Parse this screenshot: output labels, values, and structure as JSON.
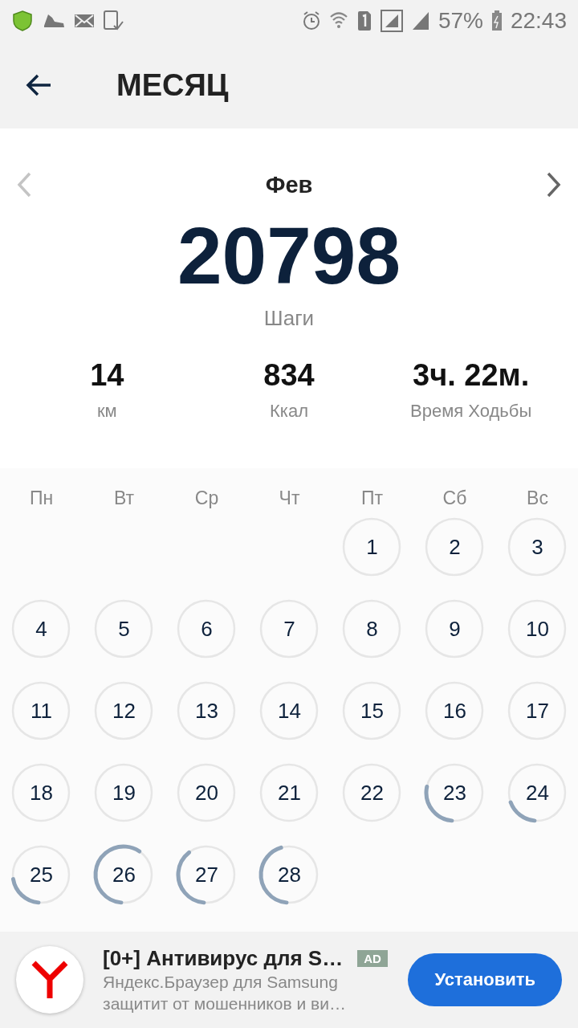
{
  "status_bar": {
    "battery": "57%",
    "time": "22:43"
  },
  "header": {
    "title": "МЕСЯЦ"
  },
  "month_nav": {
    "month": "Фев"
  },
  "summary": {
    "steps": "20798",
    "steps_label": "Шаги",
    "stats": [
      {
        "value": "14",
        "label": "км"
      },
      {
        "value": "834",
        "label": "Ккал"
      },
      {
        "value": "3ч. 22м.",
        "label": "Время Ходьбы"
      }
    ]
  },
  "calendar": {
    "weekdays": [
      "Пн",
      "Вт",
      "Ср",
      "Чт",
      "Пт",
      "Сб",
      "Вс"
    ],
    "days": [
      {
        "kind": "blank"
      },
      {
        "kind": "blank"
      },
      {
        "kind": "blank"
      },
      {
        "kind": "blank"
      },
      {
        "kind": "day",
        "label": "1",
        "active": false
      },
      {
        "kind": "day",
        "label": "2",
        "active": false
      },
      {
        "kind": "day",
        "label": "3",
        "active": false
      },
      {
        "kind": "day",
        "label": "4",
        "active": false
      },
      {
        "kind": "day",
        "label": "5",
        "active": false
      },
      {
        "kind": "day",
        "label": "6",
        "active": false
      },
      {
        "kind": "day",
        "label": "7",
        "active": false
      },
      {
        "kind": "day",
        "label": "8",
        "active": false
      },
      {
        "kind": "day",
        "label": "9",
        "active": false
      },
      {
        "kind": "day",
        "label": "10",
        "active": false
      },
      {
        "kind": "day",
        "label": "11",
        "active": false
      },
      {
        "kind": "day",
        "label": "12",
        "active": false
      },
      {
        "kind": "day",
        "label": "13",
        "active": false
      },
      {
        "kind": "day",
        "label": "14",
        "active": false
      },
      {
        "kind": "day",
        "label": "15",
        "active": false
      },
      {
        "kind": "day",
        "label": "16",
        "active": false
      },
      {
        "kind": "day",
        "label": "17",
        "active": false
      },
      {
        "kind": "day",
        "label": "18",
        "active": false
      },
      {
        "kind": "day",
        "label": "19",
        "active": false
      },
      {
        "kind": "day",
        "label": "20",
        "active": false
      },
      {
        "kind": "day",
        "label": "21",
        "active": false
      },
      {
        "kind": "day",
        "label": "22",
        "active": false
      },
      {
        "kind": "day",
        "label": "23",
        "active": true
      },
      {
        "kind": "day",
        "label": "24",
        "active": true
      },
      {
        "kind": "day",
        "label": "25",
        "active": true
      },
      {
        "kind": "day",
        "label": "26",
        "active": true
      },
      {
        "kind": "day",
        "label": "27",
        "active": true
      },
      {
        "kind": "day",
        "label": "28",
        "active": true
      }
    ]
  },
  "ad": {
    "title": "[0+] Антивирус для S…",
    "badge": "AD",
    "line_1": "Яндекс.Браузер для Samsung",
    "line_2": "защитит от мошенников и ви…",
    "button": "Установить"
  }
}
